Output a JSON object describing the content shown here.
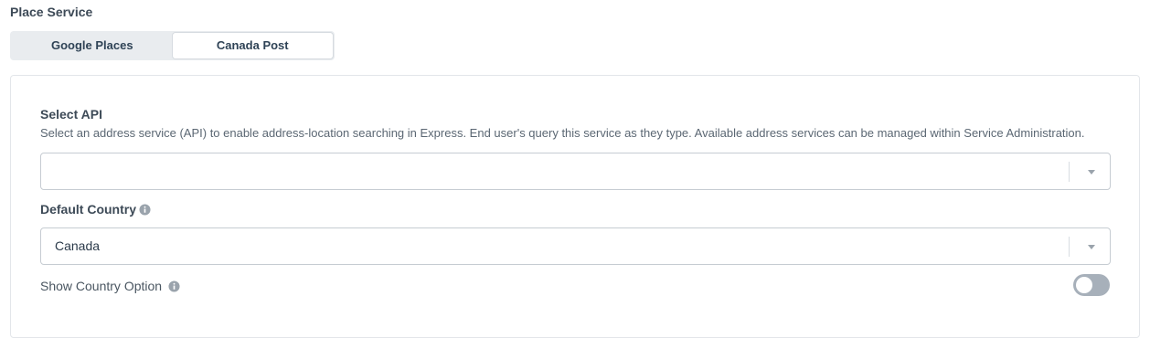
{
  "section": {
    "title": "Place Service"
  },
  "tabs": [
    {
      "label": "Google Places",
      "active": false
    },
    {
      "label": "Canada Post",
      "active": true
    }
  ],
  "select_api": {
    "label": "Select API",
    "description": "Select an address service (API) to enable address-location searching in Express. End user's query this service as they type. Available address services can be managed within Service Administration.",
    "value": ""
  },
  "default_country": {
    "label": "Default Country",
    "value": "Canada"
  },
  "show_country_option": {
    "label": "Show Country Option",
    "enabled": false
  },
  "colors": {
    "toggle_off": "#a7b0ba",
    "label_text": "#3d4a57",
    "border": "#c6ccd2"
  }
}
